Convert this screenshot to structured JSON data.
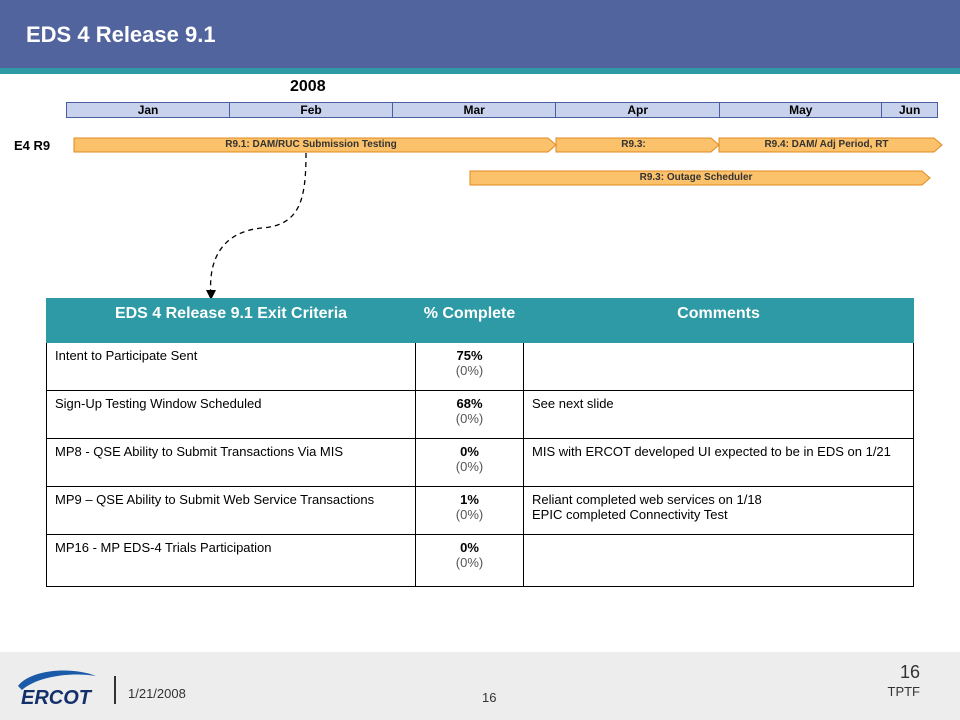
{
  "slide": {
    "title": "EDS 4 Release 9.1"
  },
  "timeline": {
    "year": "2008",
    "months": [
      "Jan",
      "Feb",
      "Mar",
      "Apr",
      "May",
      "Jun"
    ],
    "row_label": "E4 R9",
    "bars": [
      "R9.1: DAM/RUC  Submission Testing",
      "R9.3:",
      "R9.4: DAM/ Adj Period, RT",
      "R9.3: Outage  Scheduler"
    ],
    "bar_color": "#fbc16b"
  },
  "table": {
    "headers": [
      "EDS 4 Release 9.1 Exit Criteria",
      "% Complete",
      "Comments"
    ],
    "rows": [
      {
        "criteria": "Intent to Participate Sent",
        "pct": "75%",
        "pct_prev": "(0%)",
        "comments": ""
      },
      {
        "criteria": "Sign-Up Testing Window Scheduled",
        "pct": "68%",
        "pct_prev": "(0%)",
        "comments": "See next slide"
      },
      {
        "criteria": "MP8 - QSE Ability to Submit Transactions Via MIS",
        "pct": "0%",
        "pct_prev": "(0%)",
        "comments": "MIS with ERCOT developed UI expected to be in EDS on 1/21"
      },
      {
        "criteria": "MP9 – QSE Ability to Submit Web Service Transactions",
        "pct": "1%",
        "pct_prev": "(0%)",
        "comments": "Reliant completed web services on 1/18\nEPIC completed Connectivity Test"
      },
      {
        "criteria": "MP16 - MP EDS-4 Trials Participation",
        "pct": "0%",
        "pct_prev": "(0%)",
        "comments": ""
      }
    ],
    "header_color": "#2e9aa6"
  },
  "footer": {
    "logo_text": "ERCOT",
    "date": "1/21/2008",
    "page_center": "16",
    "page_right": "16",
    "org": "TPTF"
  },
  "colors": {
    "header": "#52649e",
    "accent": "#2e9aa6"
  }
}
